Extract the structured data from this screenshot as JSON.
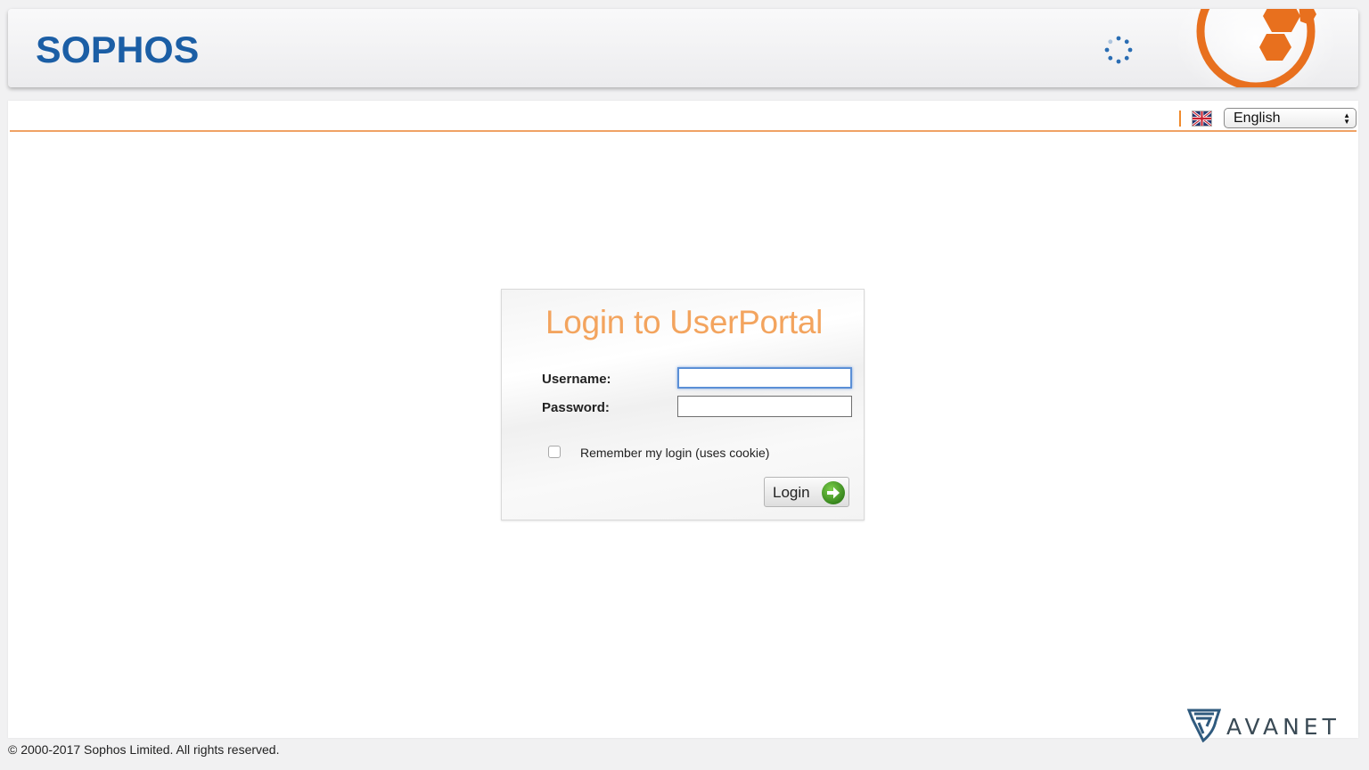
{
  "header": {
    "brand": "SOPHOS",
    "brand_color": "#1b5ea5",
    "spinner_icon": "loading-spinner-icon",
    "logo_icon": "sophos-shield-logo-icon"
  },
  "language": {
    "flag_icon": "uk-flag-icon",
    "selected": "English"
  },
  "login": {
    "title": "Login to UserPortal",
    "title_color": "#f3a45e",
    "username_label": "Username:",
    "username_value": "",
    "password_label": "Password:",
    "password_value": "",
    "remember_label": "Remember my login (uses cookie)",
    "remember_checked": false,
    "button_label": "Login",
    "button_icon": "arrow-right-circle-icon"
  },
  "footer": {
    "copyright": "© 2000-2017 Sophos Limited. All rights reserved."
  },
  "watermark": {
    "text": "AVANET",
    "icon": "avanet-shield-icon"
  },
  "colors": {
    "accent_orange": "#f08a2c",
    "focus_blue": "#5b8fd6",
    "go_green": "#4a9a2a"
  }
}
